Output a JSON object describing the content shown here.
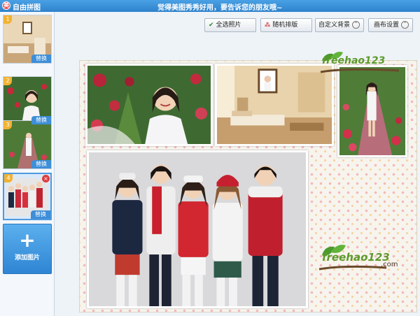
{
  "titlebar": {
    "app_title": "自由拼图",
    "promo_text": "觉得美图秀秀好用，要告诉您的朋友哦~"
  },
  "sidebar": {
    "thumbnails": [
      {
        "number": "1",
        "replace_label": "替换"
      },
      {
        "number": "2",
        "replace_label": "替换"
      },
      {
        "number": "3",
        "replace_label": "替换"
      },
      {
        "number": "4",
        "replace_label": "替换",
        "selected": true
      }
    ],
    "add_photo_label": "添加图片"
  },
  "toolbar": {
    "select_all_label": "全选照片",
    "random_layout_label": "随机排版",
    "custom_background_label": "自定义背景",
    "canvas_settings_label": "画布设置"
  },
  "watermark": {
    "brand": "freehao123",
    "suffix": ".com"
  },
  "colors": {
    "titlebar": "#2e82cc",
    "accent_blue": "#3e8ed8",
    "thumb_number": "#f3b232",
    "close_red": "#e03b3b"
  }
}
